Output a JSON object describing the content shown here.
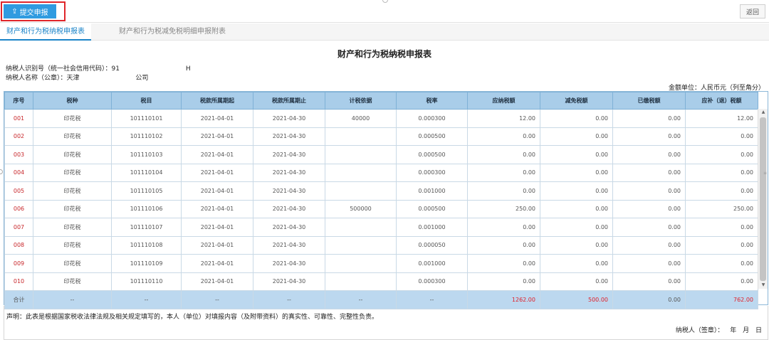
{
  "toolbar": {
    "submit_label": "提交申报",
    "back_label": "返回"
  },
  "tabs": [
    {
      "label": "财产和行为税纳税申报表",
      "active": true
    },
    {
      "label": "财产和行为税减免税明细申报附表",
      "active": false
    }
  ],
  "title": "财产和行为税纳税申报表",
  "taxpayer": {
    "id_label": "纳税人识别号（统一社会信用代码）：91",
    "id_suffix": "H",
    "name_label": "纳税人名称（公章）：天津",
    "name_suffix": "公司"
  },
  "unit": "金额单位：人民币元（列至角分）",
  "table": {
    "headers": [
      "序号",
      "税种",
      "税目",
      "税款所属期起",
      "税款所属期止",
      "计税依据",
      "税率",
      "应纳税额",
      "减免税额",
      "已缴税额",
      "应补（退）税额"
    ],
    "rows": [
      [
        "001",
        "印花税",
        "101110101",
        "2021-04-01",
        "2021-04-30",
        "40000",
        "0.000300",
        "12.00",
        "0.00",
        "0.00",
        "12.00"
      ],
      [
        "002",
        "印花税",
        "101110102",
        "2021-04-01",
        "2021-04-30",
        "",
        "0.000500",
        "0.00",
        "0.00",
        "0.00",
        "0.00"
      ],
      [
        "003",
        "印花税",
        "101110103",
        "2021-04-01",
        "2021-04-30",
        "",
        "0.000500",
        "0.00",
        "0.00",
        "0.00",
        "0.00"
      ],
      [
        "004",
        "印花税",
        "101110104",
        "2021-04-01",
        "2021-04-30",
        "",
        "0.000300",
        "0.00",
        "0.00",
        "0.00",
        "0.00"
      ],
      [
        "005",
        "印花税",
        "101110105",
        "2021-04-01",
        "2021-04-30",
        "",
        "0.001000",
        "0.00",
        "0.00",
        "0.00",
        "0.00"
      ],
      [
        "006",
        "印花税",
        "101110106",
        "2021-04-01",
        "2021-04-30",
        "500000",
        "0.000500",
        "250.00",
        "0.00",
        "0.00",
        "250.00"
      ],
      [
        "007",
        "印花税",
        "101110107",
        "2021-04-01",
        "2021-04-30",
        "",
        "0.001000",
        "0.00",
        "0.00",
        "0.00",
        "0.00"
      ],
      [
        "008",
        "印花税",
        "101110108",
        "2021-04-01",
        "2021-04-30",
        "",
        "0.000050",
        "0.00",
        "0.00",
        "0.00",
        "0.00"
      ],
      [
        "009",
        "印花税",
        "101110109",
        "2021-04-01",
        "2021-04-30",
        "",
        "0.001000",
        "0.00",
        "0.00",
        "0.00",
        "0.00"
      ],
      [
        "010",
        "印花税",
        "101110110",
        "2021-04-01",
        "2021-04-30",
        "",
        "0.000300",
        "0.00",
        "0.00",
        "0.00",
        "0.00"
      ]
    ],
    "total": [
      "合计",
      "--",
      "--",
      "--",
      "--",
      "--",
      "--",
      "1262.00",
      "500.00",
      "0.00",
      "762.00"
    ]
  },
  "declaration": "声明：此表是根据国家税收法律法规及相关规定填写的，本人（单位）对填报内容（及附带资料）的真实性、可靠性、完整性负责。",
  "sign": "纳税人（签章）：  年  月  日",
  "colors": {
    "accent": "#2f9be0",
    "header_bg": "#a9cde9",
    "red": "#e0202a"
  }
}
